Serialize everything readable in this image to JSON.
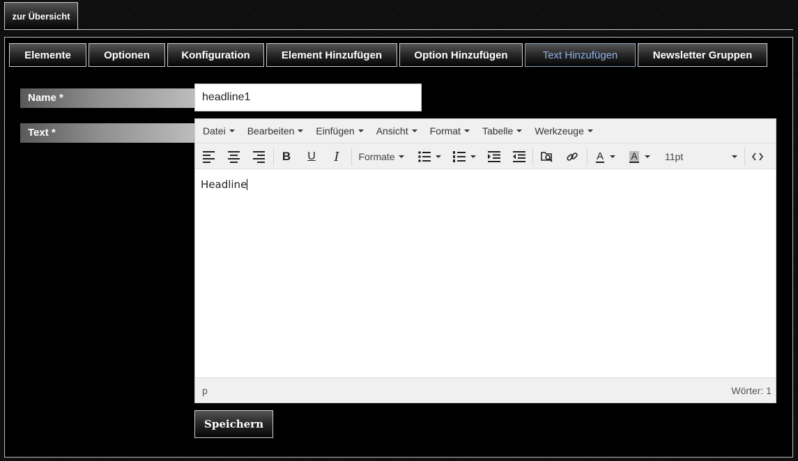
{
  "back_button": {
    "label": "zur Übersicht"
  },
  "tabs": [
    {
      "label": "Elemente",
      "active": false
    },
    {
      "label": "Optionen",
      "active": false
    },
    {
      "label": "Konfiguration",
      "active": false
    },
    {
      "label": "Element Hinzufügen",
      "active": false
    },
    {
      "label": "Option Hinzufügen",
      "active": false
    },
    {
      "label": "Text Hinzufügen",
      "active": true
    },
    {
      "label": "Newsletter Gruppen",
      "active": false
    }
  ],
  "form": {
    "name_label": "Name *",
    "name_value": "headline1",
    "text_label": "Text *"
  },
  "editor": {
    "menu": [
      "Datei",
      "Bearbeiten",
      "Einfügen",
      "Ansicht",
      "Format",
      "Tabelle",
      "Werkzeuge"
    ],
    "toolbar": {
      "formats_label": "Formate",
      "font_size": "11pt",
      "text_color_glyph": "A",
      "bg_color_glyph": "A",
      "bold_glyph": "B",
      "underline_glyph": "U",
      "italic_glyph": "I",
      "icons": [
        "align-left-icon",
        "align-center-icon",
        "align-right-icon",
        "bold-icon",
        "underline-icon",
        "italic-icon",
        "bullet-list-icon",
        "numbered-list-icon",
        "indent-icon",
        "outdent-icon",
        "search-replace-icon",
        "link-icon",
        "text-color-icon",
        "background-color-icon",
        "source-code-icon"
      ]
    },
    "content": "Headline",
    "status_path": "p",
    "word_count": "Wörter: 1"
  },
  "save_button": {
    "label": "Speichern"
  },
  "colors": {
    "active_tab_text": "#8fb2e6",
    "page_bg": "#000000",
    "toolbar_bg": "#f0f0f0"
  }
}
